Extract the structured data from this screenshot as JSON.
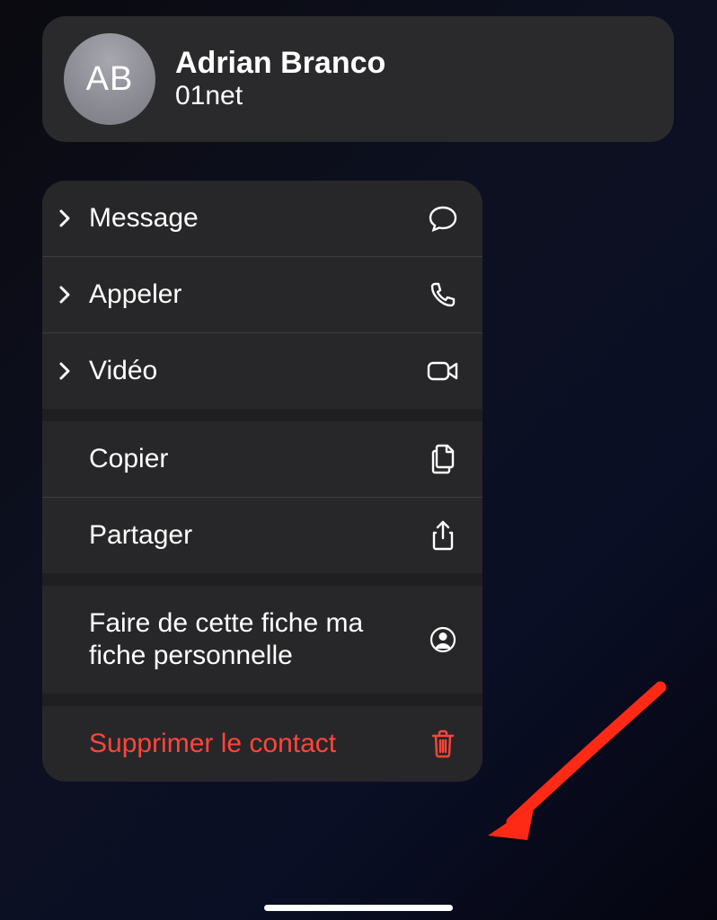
{
  "contact": {
    "initials": "AB",
    "name": "Adrian Branco",
    "org": "01net"
  },
  "menu": {
    "message": "Message",
    "call": "Appeler",
    "video": "Vidéo",
    "copy": "Copier",
    "share": "Partager",
    "my_card": "Faire de cette fiche ma fiche personnelle",
    "delete": "Supprimer le contact"
  },
  "colors": {
    "destructive": "#ff453a",
    "card_bg": "#2a2a2c",
    "menu_bg": "#272729"
  }
}
